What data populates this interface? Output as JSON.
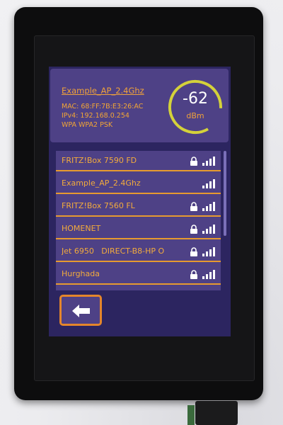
{
  "access_point": {
    "ssid": "Example_AP_2.4Ghz",
    "mac": "MAC: 68:FF:7B:E3:26:AC",
    "ipv4": "IPv4: 192.168.0.254",
    "security": "WPA WPA2 PSK",
    "rssi_value": "-62",
    "rssi_unit": "dBm"
  },
  "colors": {
    "background": "#2c2560",
    "card": "#4e4186",
    "accent": "#f0a23a",
    "ring": "#d4d23a"
  },
  "networks": [
    {
      "name": "FRITZ!Box 7590 FD",
      "secured": true,
      "signal_bars": 4
    },
    {
      "name": "Example_AP_2.4Ghz",
      "secured": false,
      "signal_bars": 4
    },
    {
      "name": "FRITZ!Box 7560 FL",
      "secured": true,
      "signal_bars": 4
    },
    {
      "name": "HOMENET",
      "secured": true,
      "signal_bars": 4
    },
    {
      "name": "Jet 6950   DIRECT-B8-HP O",
      "secured": true,
      "signal_bars": 4
    },
    {
      "name": "Hurghada",
      "secured": true,
      "signal_bars": 4
    }
  ],
  "back_button": {
    "icon": "back-arrow-icon"
  }
}
